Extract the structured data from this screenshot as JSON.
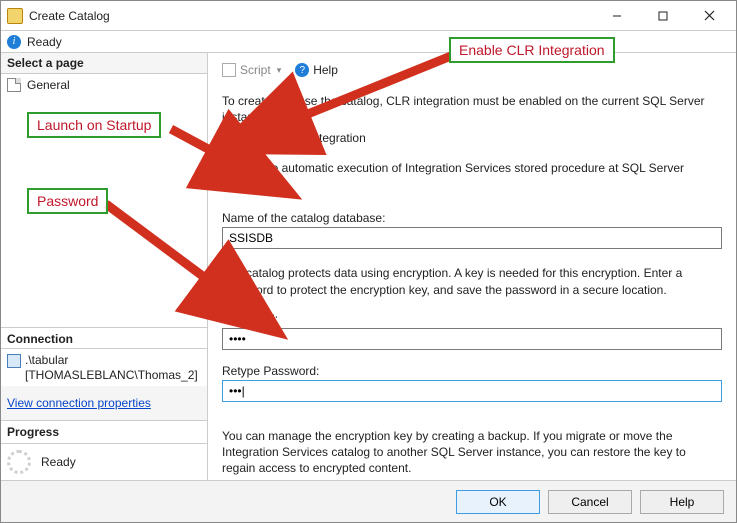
{
  "window": {
    "title": "Create Catalog"
  },
  "status": {
    "text": "Ready"
  },
  "sidebar": {
    "select_page_header": "Select a page",
    "pages": [
      {
        "label": "General"
      }
    ],
    "connection_header": "Connection",
    "connection_server": ".\\tabular",
    "connection_user": "[THOMASLEBLANC\\Thomas_2]",
    "view_conn_props": "View connection properties",
    "progress_header": "Progress",
    "progress_text": "Ready"
  },
  "toolbar": {
    "script_label": "Script",
    "help_label": "Help"
  },
  "main": {
    "intro": "To create and use the catalog, CLR integration must be enabled on the current SQL Server instance.",
    "chk_clr": "Enable CLR Integration",
    "chk_auto": "Enable automatic execution of Integration Services stored procedure at SQL Server startup.",
    "db_name_label": "Name of the catalog database:",
    "db_name_value": "SSISDB",
    "pwd_intro": "The catalog protects data using encryption. A key is needed for this encryption. Enter a password to protect the encryption key, and save the password in a secure location.",
    "pwd_label": "Password:",
    "pwd_value": "••••",
    "pwd2_label": "Retype Password:",
    "pwd2_value": "•••|",
    "footer": "You can manage the encryption key by creating a backup. If you migrate or move the Integration Services catalog to another SQL Server instance, you can restore the key to regain access to encrypted content."
  },
  "buttons": {
    "ok": "OK",
    "cancel": "Cancel",
    "help": "Help"
  },
  "annotations": {
    "clr": "Enable CLR Integration",
    "startup": "Launch on Startup",
    "password": "Password"
  }
}
